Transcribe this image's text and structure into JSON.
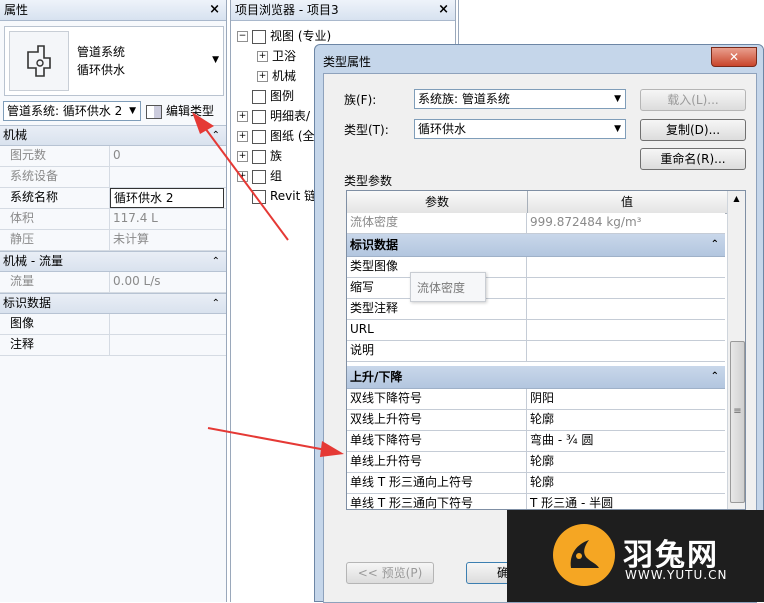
{
  "properties_panel": {
    "title": "属性",
    "close": "×",
    "type_selector": {
      "family": "管道系统",
      "type": "循环供水"
    },
    "instance_combo": "管道系统: 循环供水 2",
    "edit_type_label": "编辑类型",
    "sections": [
      {
        "name": "机械",
        "rows": [
          {
            "k": "图元数",
            "v": "0",
            "grey": true
          },
          {
            "k": "系统设备",
            "v": "",
            "grey": true
          },
          {
            "k": "系统名称",
            "v": "循环供水 2",
            "grey": false,
            "editing": true
          },
          {
            "k": "体积",
            "v": "117.4 L",
            "grey": true
          },
          {
            "k": "静压",
            "v": "未计算",
            "grey": true
          }
        ]
      },
      {
        "name": "机械 - 流量",
        "rows": [
          {
            "k": "流量",
            "v": "0.00 L/s",
            "grey": true
          }
        ]
      },
      {
        "name": "标识数据",
        "rows": [
          {
            "k": "图像",
            "v": "",
            "grey": false
          },
          {
            "k": "注释",
            "v": "",
            "grey": false
          }
        ]
      }
    ]
  },
  "project_browser": {
    "title": "项目浏览器 - 项目3",
    "close": "×",
    "items": [
      {
        "label": "视图 (专业)",
        "indent": 0,
        "expander": "−",
        "icon": "view-icon"
      },
      {
        "label": "卫浴",
        "indent": 1,
        "expander": "+",
        "icon": ""
      },
      {
        "label": "机械",
        "indent": 1,
        "expander": "+",
        "icon": ""
      },
      {
        "label": "图例",
        "indent": 0,
        "expander": "",
        "icon": "legend-icon"
      },
      {
        "label": "明细表/",
        "indent": 0,
        "expander": "+",
        "icon": "schedule-icon"
      },
      {
        "label": "图纸 (全",
        "indent": 0,
        "expander": "+",
        "icon": "sheet-icon"
      },
      {
        "label": "族",
        "indent": 0,
        "expander": "+",
        "icon": "family-icon"
      },
      {
        "label": "组",
        "indent": 0,
        "expander": "+",
        "icon": "group-icon"
      },
      {
        "label": "Revit 链",
        "indent": 0,
        "expander": "",
        "icon": "link-icon"
      }
    ]
  },
  "dialog": {
    "title": "类型属性",
    "close": "✕",
    "family_label": "族(F):",
    "family_value": "系统族: 管道系统",
    "type_label": "类型(T):",
    "type_value": "循环供水",
    "load_btn": "载入(L)...",
    "duplicate_btn": "复制(D)...",
    "rename_btn": "重命名(R)...",
    "type_params_label": "类型参数",
    "col_param": "参数",
    "col_value": "值",
    "top_row": {
      "k": "流体密度",
      "v": "999.872484 kg/m³"
    },
    "tooltip": "流体密度",
    "groups": [
      {
        "name": "标识数据",
        "rows": [
          {
            "k": "类型图像",
            "v": ""
          },
          {
            "k": "缩写",
            "v": ""
          },
          {
            "k": "类型注释",
            "v": ""
          },
          {
            "k": "URL",
            "v": ""
          },
          {
            "k": "说明",
            "v": ""
          }
        ]
      },
      {
        "name": "上升/下降",
        "rows": [
          {
            "k": "双线下降符号",
            "v": "阴阳"
          },
          {
            "k": "双线上升符号",
            "v": "轮廓"
          },
          {
            "k": "单线下降符号",
            "v": "弯曲 - ¾ 圆"
          },
          {
            "k": "单线上升符号",
            "v": "轮廓"
          },
          {
            "k": "单线 T 形三通向上符号",
            "v": "轮廓"
          },
          {
            "k": "单线 T 形三通向下符号",
            "v": "T 形三通 - 半圆"
          }
        ]
      }
    ],
    "preview_btn": "<< 预览(P)",
    "ok_btn": "确"
  },
  "watermark": {
    "brand": "羽兔网",
    "url": "WWW.YUTU.CN"
  },
  "colors": {
    "arrow": "#e53935",
    "watermark_bg": "#1e1e1e",
    "watermark_accent": "#f5a623"
  }
}
